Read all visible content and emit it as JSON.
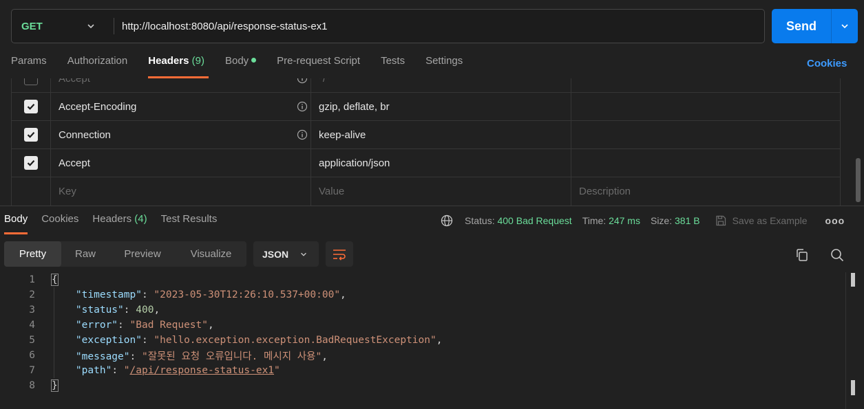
{
  "request": {
    "method": "GET",
    "url": "http://localhost:8080/api/response-status-ex1",
    "send_label": "Send"
  },
  "request_tabs": [
    {
      "label": "Params"
    },
    {
      "label": "Authorization"
    },
    {
      "label": "Headers",
      "count": "(9)",
      "active": true
    },
    {
      "label": "Body",
      "dot": true
    },
    {
      "label": "Pre-request Script"
    },
    {
      "label": "Tests"
    },
    {
      "label": "Settings"
    }
  ],
  "cookies_label": "Cookies",
  "headers_table": {
    "rows": [
      {
        "checked": false,
        "key": "Accept",
        "value": "*/*",
        "info": true
      },
      {
        "checked": true,
        "key": "Accept-Encoding",
        "value": "gzip, deflate, br",
        "info": true
      },
      {
        "checked": true,
        "key": "Connection",
        "value": "keep-alive",
        "info": true
      },
      {
        "checked": true,
        "key": "Accept",
        "value": "application/json",
        "info": false
      }
    ],
    "placeholder": {
      "key": "Key",
      "value": "Value",
      "description": "Description"
    }
  },
  "response_tabs": [
    {
      "label": "Body",
      "active": true
    },
    {
      "label": "Cookies"
    },
    {
      "label": "Headers",
      "count": "(4)"
    },
    {
      "label": "Test Results"
    }
  ],
  "response_status": {
    "status_label": "Status:",
    "status_value": "400 Bad Request",
    "time_label": "Time:",
    "time_value": "247 ms",
    "size_label": "Size:",
    "size_value": "381 B",
    "save_example": "Save as Example",
    "more": "ooo"
  },
  "view_modes": [
    "Pretty",
    "Raw",
    "Preview",
    "Visualize"
  ],
  "active_view_mode": "Pretty",
  "format": "JSON",
  "response_body": {
    "line_numbers": [
      "1",
      "2",
      "3",
      "4",
      "5",
      "6",
      "7",
      "8"
    ],
    "open_brace": "{",
    "close_brace": "}",
    "fields": [
      {
        "key": "\"timestamp\"",
        "value": "\"2023-05-30T12:26:10.537+00:00\"",
        "type": "string"
      },
      {
        "key": "\"status\"",
        "value": "400",
        "type": "number"
      },
      {
        "key": "\"error\"",
        "value": "\"Bad Request\"",
        "type": "string"
      },
      {
        "key": "\"exception\"",
        "value": "\"hello.exception.exception.BadRequestException\"",
        "type": "string"
      },
      {
        "key": "\"message\"",
        "value": "\"잘못된 요청 오류입니다. 메시지 사용\"",
        "type": "string"
      },
      {
        "key": "\"path\"",
        "value_open_quote": "\"",
        "value_link": "/api/response-status-ex1",
        "value_close_quote": "\"",
        "type": "link"
      }
    ]
  },
  "colors": {
    "accent": "#ff6c37",
    "send": "#097bed",
    "success": "#6bdd9a",
    "link": "#3d9bff"
  }
}
